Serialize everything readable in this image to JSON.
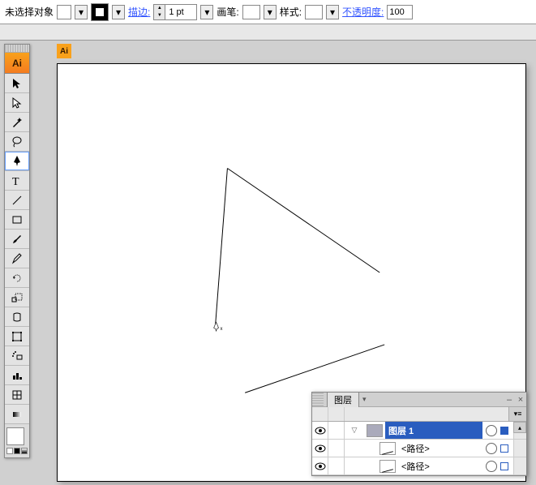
{
  "topbar": {
    "selection_label": "未选择对象",
    "stroke_label": "描边:",
    "stroke_weight": "1 pt",
    "brush_label": "画笔:",
    "brush_value": "-",
    "style_label": "样式:",
    "opacity_label": "不透明度:",
    "opacity_value": "100"
  },
  "app_badge": "Ai",
  "doc_badge": "Ai",
  "tools": [
    "selection-tool",
    "direct-selection-tool",
    "magic-wand-tool",
    "lasso-tool",
    "pen-tool",
    "type-tool",
    "line-segment-tool",
    "rectangle-tool",
    "paintbrush-tool",
    "pencil-tool",
    "rotate-tool",
    "scale-tool",
    "warp-tool",
    "free-transform-tool",
    "symbol-sprayer-tool",
    "column-graph-tool",
    "mesh-tool",
    "gradient-tool"
  ],
  "active_tool": "pen-tool",
  "layers_panel": {
    "title": "图层",
    "rows": [
      {
        "type": "layer",
        "name": "图层 1",
        "selected": true
      },
      {
        "type": "path",
        "name": "<路径>",
        "selected": false
      },
      {
        "type": "path",
        "name": "<路径>",
        "selected": false
      }
    ]
  }
}
